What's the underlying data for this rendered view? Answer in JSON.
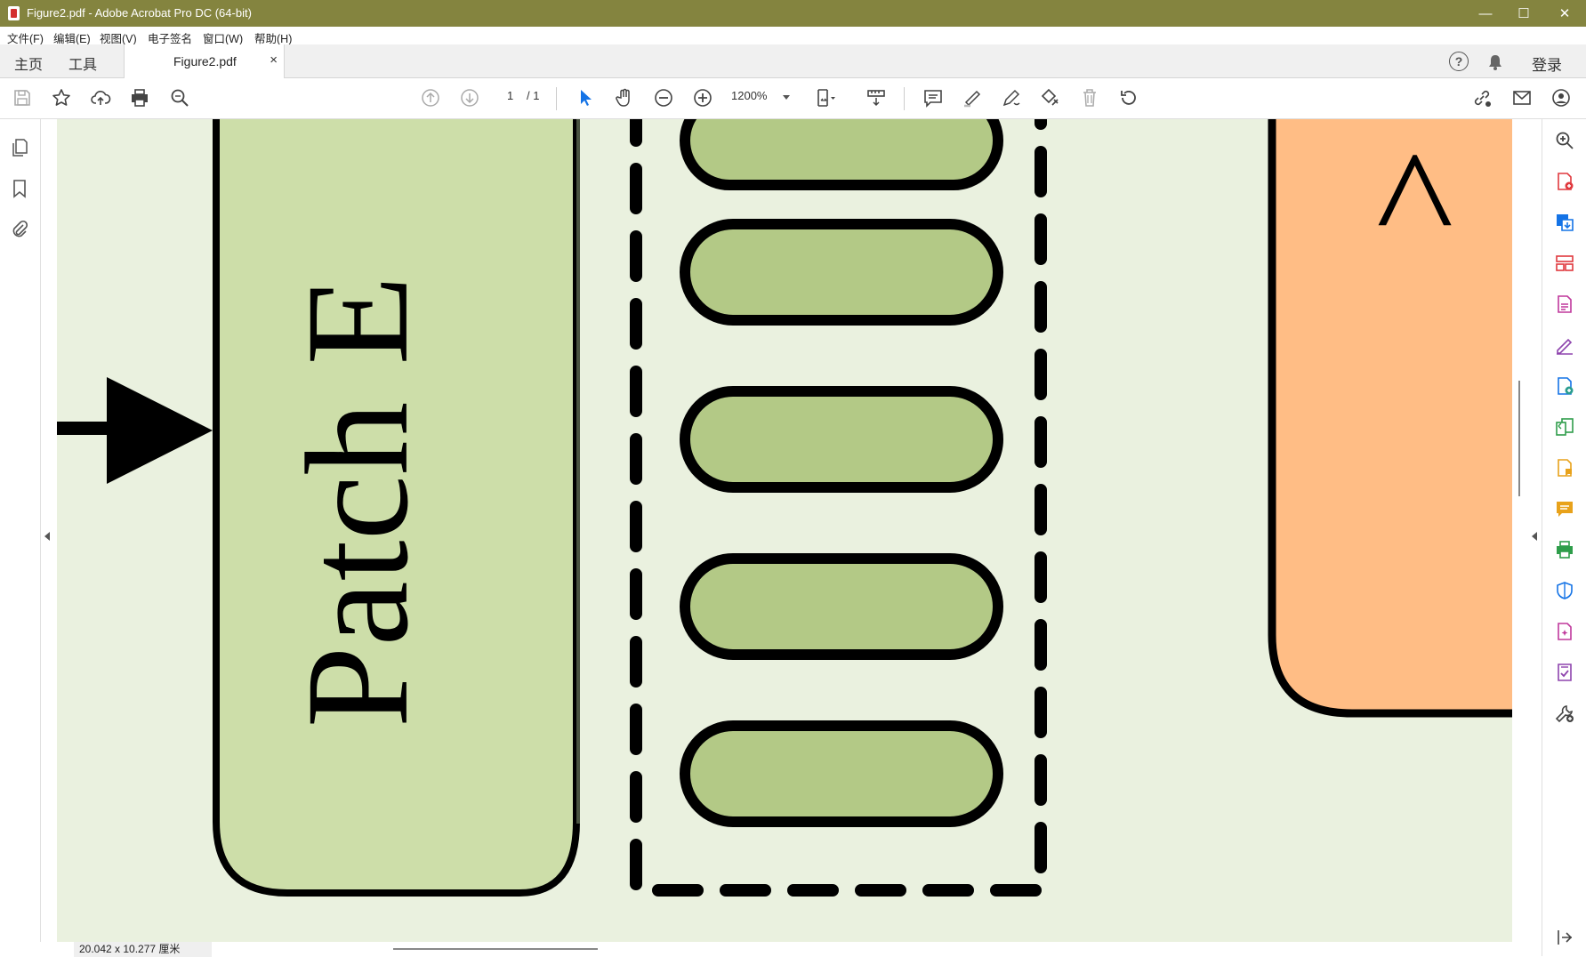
{
  "window": {
    "title": "Figure2.pdf - Adobe Acrobat Pro DC (64-bit)",
    "minimize": "—",
    "maximize": "☐",
    "close": "✕"
  },
  "menu": [
    "文件(F)",
    "编辑(E)",
    "视图(V)",
    "电子签名",
    "窗口(W)",
    "帮助(H)"
  ],
  "tabs": {
    "home": "主页",
    "tools": "工具",
    "document": "Figure2.pdf",
    "close": "×",
    "signin": "登录",
    "help": "?"
  },
  "toolbar": {
    "page_current": "1",
    "page_total": "/ 1",
    "zoom": "1200%"
  },
  "document": {
    "patch_label": "Patch E",
    "orange_glyph": ">"
  },
  "status": {
    "dimensions": "20.042 x 10.277 厘米"
  },
  "colors": {
    "titlebar": "#84843f",
    "page_bg": "#eaf1df",
    "patch_fill": "#cddea9",
    "pill_fill": "#b3c986",
    "orange_fill": "#ffbd85",
    "tool_blue": "#1473e6"
  }
}
